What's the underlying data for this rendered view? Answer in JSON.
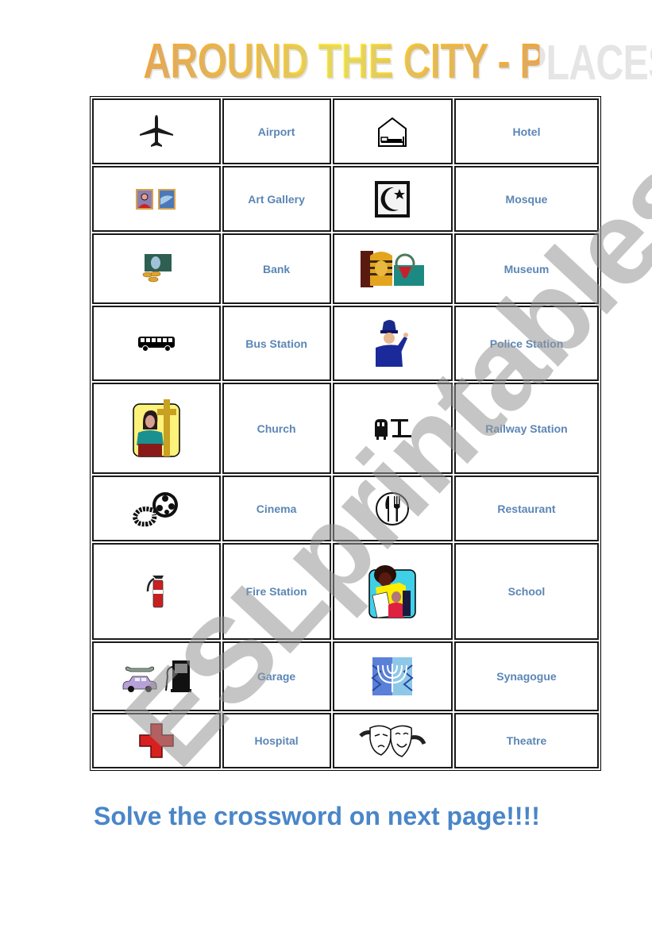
{
  "title": "AROUND THE CITY - PLACES",
  "rows": [
    {
      "left": {
        "icon": "airplane-icon",
        "label": "Airport"
      },
      "right": {
        "icon": "hotel-icon",
        "label": "Hotel"
      }
    },
    {
      "left": {
        "icon": "art-gallery-icon",
        "label": "Art Gallery"
      },
      "right": {
        "icon": "mosque-icon",
        "label": "Mosque"
      }
    },
    {
      "left": {
        "icon": "bank-icon",
        "label": "Bank"
      },
      "right": {
        "icon": "museum-icon",
        "label": "Museum"
      }
    },
    {
      "left": {
        "icon": "bus-icon",
        "label": "Bus Station"
      },
      "right": {
        "icon": "police-officer-icon",
        "label": "Police Station"
      }
    },
    {
      "left": {
        "icon": "church-icon",
        "label": "Church"
      },
      "right": {
        "icon": "railway-icon",
        "label": "Railway Station"
      }
    },
    {
      "left": {
        "icon": "film-reel-icon",
        "label": "Cinema"
      },
      "right": {
        "icon": "restaurant-icon",
        "label": "Restaurant"
      }
    },
    {
      "left": {
        "icon": "fire-extinguisher-icon",
        "label": "Fire Station"
      },
      "right": {
        "icon": "school-icon",
        "label": "School"
      }
    },
    {
      "left": {
        "icon": "garage-icon",
        "label": "Garage"
      },
      "right": {
        "icon": "synagogue-icon",
        "label": "Synagogue"
      }
    },
    {
      "left": {
        "icon": "hospital-cross-icon",
        "label": "Hospital"
      },
      "right": {
        "icon": "theatre-masks-icon",
        "label": "Theatre"
      }
    }
  ],
  "footer": "Solve the crossword on next page!!!!",
  "watermark": "ESLprintables.com",
  "colors": {
    "label": "#5b86b5",
    "footer": "#4a86c8",
    "title_gradient": [
      "#f7a22e",
      "#ffee33"
    ]
  }
}
